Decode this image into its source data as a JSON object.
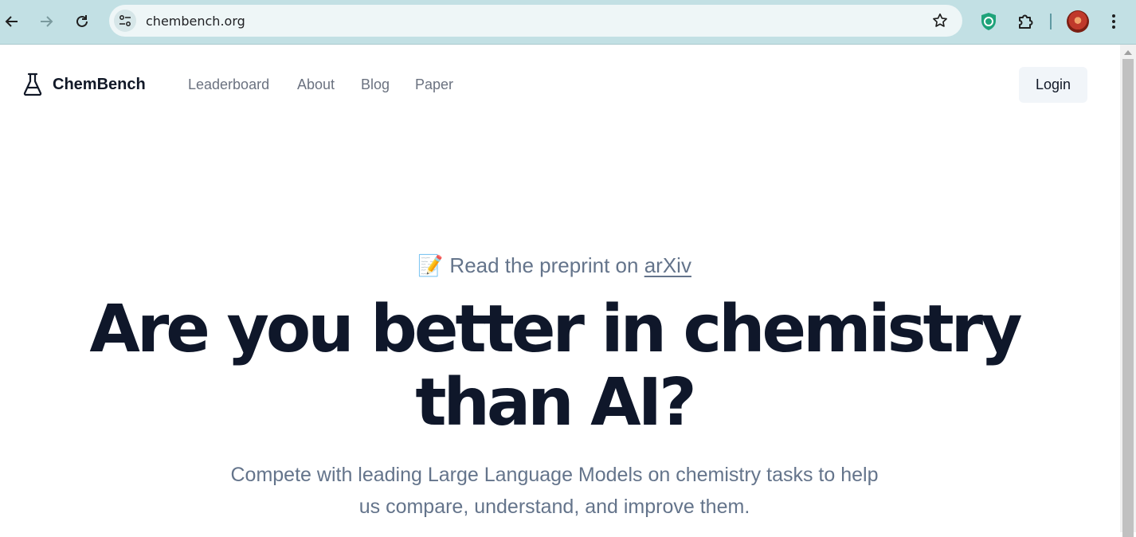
{
  "browser": {
    "url": "chembench.org",
    "icons": {
      "back": "back-arrow-icon",
      "forward": "forward-arrow-icon",
      "reload": "reload-icon",
      "site_info": "site-settings-icon",
      "bookmark": "star-icon",
      "extension_shield": "shield-extension-icon",
      "extensions": "puzzle-icon",
      "menu": "kebab-menu-icon"
    },
    "accent": "#c2e0e4"
  },
  "site": {
    "brand": "ChemBench",
    "nav": [
      "Leaderboard",
      "About",
      "Blog",
      "Paper"
    ],
    "login_label": "Login"
  },
  "hero": {
    "preprint_emoji": "📝",
    "preprint_text": "Read the preprint on",
    "preprint_link": "arXiv",
    "title_line1": "Are you better in chemistry",
    "title_line2": "than AI?",
    "subtitle": "Compete with leading Large Language Models on chemistry tasks to help us compare, understand, and improve them."
  },
  "colors": {
    "title": "#0f172a",
    "muted": "#64748b",
    "nav": "#6b7280"
  }
}
